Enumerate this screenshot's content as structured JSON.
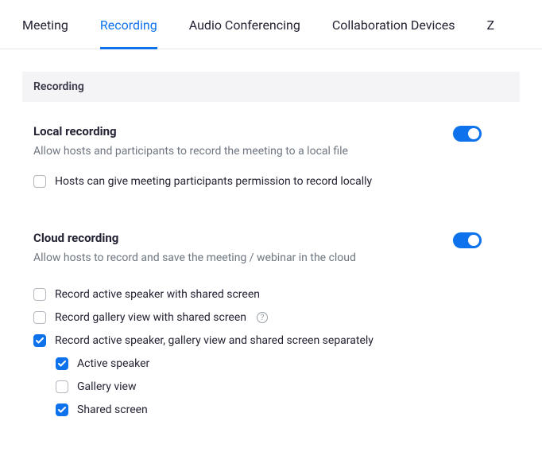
{
  "tabs": {
    "meeting": "Meeting",
    "recording": "Recording",
    "audio": "Audio Conferencing",
    "collab": "Collaboration Devices",
    "zextra": "Z"
  },
  "section_header": "Recording",
  "local": {
    "title": "Local recording",
    "desc": "Allow hosts and participants to record the meeting to a local file",
    "checkbox_permission": "Hosts can give meeting participants permission to record locally"
  },
  "cloud": {
    "title": "Cloud recording",
    "desc": "Allow hosts to record and save the meeting / webinar in the cloud",
    "record_active_shared": "Record active speaker with shared screen",
    "record_gallery_shared": "Record gallery view with shared screen",
    "record_separately": "Record active speaker, gallery view and shared screen separately",
    "sub_active": "Active speaker",
    "sub_gallery": "Gallery view",
    "sub_shared": "Shared screen"
  }
}
